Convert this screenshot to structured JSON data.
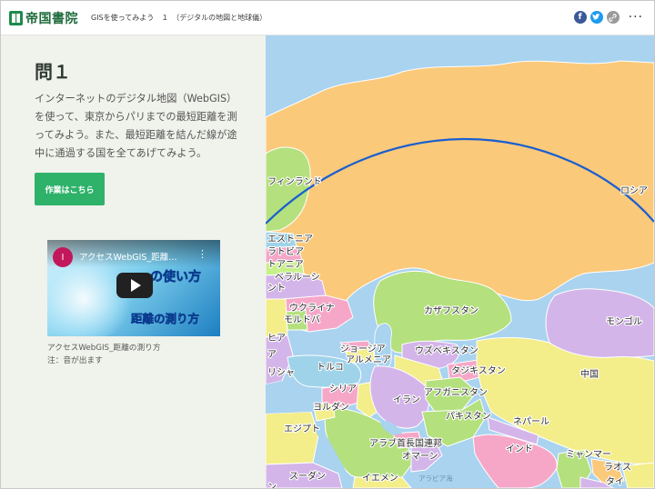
{
  "header": {
    "logo_text": "帝国書院",
    "story_title": "GISを使ってみよう　１　（デジタルの地図と地球儀）",
    "share_icons": [
      "facebook-icon",
      "twitter-icon",
      "link-icon"
    ],
    "more_label": "···"
  },
  "panel": {
    "question_title": "問１",
    "question_text": "インターネットのデジタル地図（WebGIS）を使って、東京からパリまでの最短距離を測ってみよう。また、最短距離を結んだ線が途中に通過する国を全てあげてみよう。",
    "work_button_label": "作業はこちら",
    "video": {
      "channel_initial": "I",
      "title": "アクセスWebGIS_距離…",
      "overlay_line1": "の使い方",
      "overlay_line2": "距離の測り方"
    },
    "caption_line1": "アクセスWebGIS_距離の測り方",
    "caption_line2": "注：音が出ます"
  },
  "map": {
    "labels": {
      "finland": "フィンランド",
      "russia": "ロシア",
      "estonia": "エストニア",
      "latvia": "ラトビア",
      "lithuania": "トアニア",
      "belarus": "ベラルーシ",
      "ukraine": "ウクライナ",
      "moldova": "モルドバ",
      "kazakhstan": "カザフスタン",
      "mongolia": "モンゴル",
      "georgia": "ジョージア",
      "armenia": "アルメニア",
      "uzbekistan": "ウズベキスタン",
      "tajikistan": "タジキスタン",
      "turkey": "トルコ",
      "syria": "シリア",
      "china": "中国",
      "iran": "イラン",
      "afghanistan": "アフガニスタン",
      "jordan": "ヨルダン",
      "pakistan": "パキスタン",
      "nepal": "ネパール",
      "egypt": "エジプト",
      "uae": "アラブ首長国連邦",
      "oman": "オマーン",
      "india": "インド",
      "myanmar": "ミャンマー",
      "laos": "ラオス",
      "thailand": "タイ",
      "sudan": "スーダン",
      "yemen": "イエメン",
      "arabian_sea": "アラビア海",
      "frag_nto": "ント",
      "frag_hia": "ヒア",
      "frag_ia": "ア",
      "frag_ria": "リシャ",
      "frag_n": "ン"
    },
    "colors": {
      "sea": "#a9d3ef",
      "russia": "#fbc97a",
      "route_line": "#1a5fd0"
    }
  }
}
